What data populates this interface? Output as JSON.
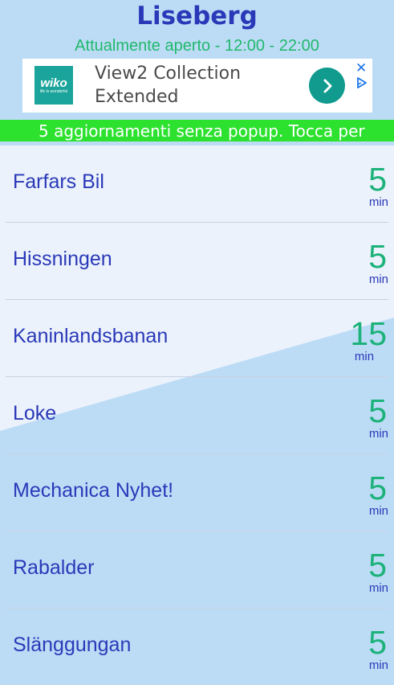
{
  "app": {
    "title": "Liseberg",
    "status": "Attualmente aperto - 12:00 - 22:00"
  },
  "ad": {
    "brand": "wiko",
    "brand_tagline": "life is wonderful",
    "line1": "View2 Collection",
    "line2": "Extended",
    "close_label": "✕"
  },
  "banner": {
    "text": "5 aggiornamenti senza popup. Tocca per"
  },
  "rides": [
    {
      "name": "Farfars Bil",
      "wait": "5",
      "unit": "min"
    },
    {
      "name": "Hissningen",
      "wait": "5",
      "unit": "min"
    },
    {
      "name": "Kaninlandsbanan",
      "wait": "15",
      "unit": "min"
    },
    {
      "name": "Loke",
      "wait": "5",
      "unit": "min"
    },
    {
      "name": "Mechanica Nyhet!",
      "wait": "5",
      "unit": "min"
    },
    {
      "name": "Rabalder",
      "wait": "5",
      "unit": "min"
    },
    {
      "name": "Slänggungan",
      "wait": "5",
      "unit": "min"
    }
  ],
  "colors": {
    "title": "#2a39b8",
    "status": "#21b86c",
    "banner": "#2de12f",
    "wait_number": "#1cb27a",
    "background_light": "#ebf2fb",
    "background_blue": "#bcdcf6"
  }
}
